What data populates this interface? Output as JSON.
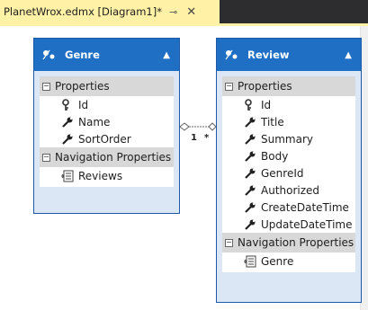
{
  "tab": {
    "title": "PlanetWrox.edmx [Diagram1]*",
    "pin_glyph": "⊸",
    "close_glyph": "✕"
  },
  "entities": {
    "genre": {
      "name": "Genre",
      "properties_label": "Properties",
      "properties": [
        {
          "label": "Id",
          "icon": "key-icon"
        },
        {
          "label": "Name",
          "icon": "wrench-icon"
        },
        {
          "label": "SortOrder",
          "icon": "wrench-icon"
        }
      ],
      "nav_label": "Navigation Properties",
      "nav_properties": [
        {
          "label": "Reviews",
          "icon": "navigation-property-icon"
        }
      ]
    },
    "review": {
      "name": "Review",
      "properties_label": "Properties",
      "properties": [
        {
          "label": "Id",
          "icon": "key-icon"
        },
        {
          "label": "Title",
          "icon": "wrench-icon"
        },
        {
          "label": "Summary",
          "icon": "wrench-icon"
        },
        {
          "label": "Body",
          "icon": "wrench-icon"
        },
        {
          "label": "GenreId",
          "icon": "wrench-icon"
        },
        {
          "label": "Authorized",
          "icon": "wrench-icon"
        },
        {
          "label": "CreateDateTime",
          "icon": "wrench-icon"
        },
        {
          "label": "UpdateDateTime",
          "icon": "wrench-icon"
        }
      ],
      "nav_label": "Navigation Properties",
      "nav_properties": [
        {
          "label": "Genre",
          "icon": "navigation-property-icon"
        }
      ]
    }
  },
  "association": {
    "left_multiplicity": "1",
    "right_multiplicity": "*"
  },
  "colors": {
    "tab_bg": "#fff1a6",
    "header_bg": "#1f6fc5",
    "section_bg": "#d8d8d8",
    "entity_border": "#1e5aa8"
  }
}
